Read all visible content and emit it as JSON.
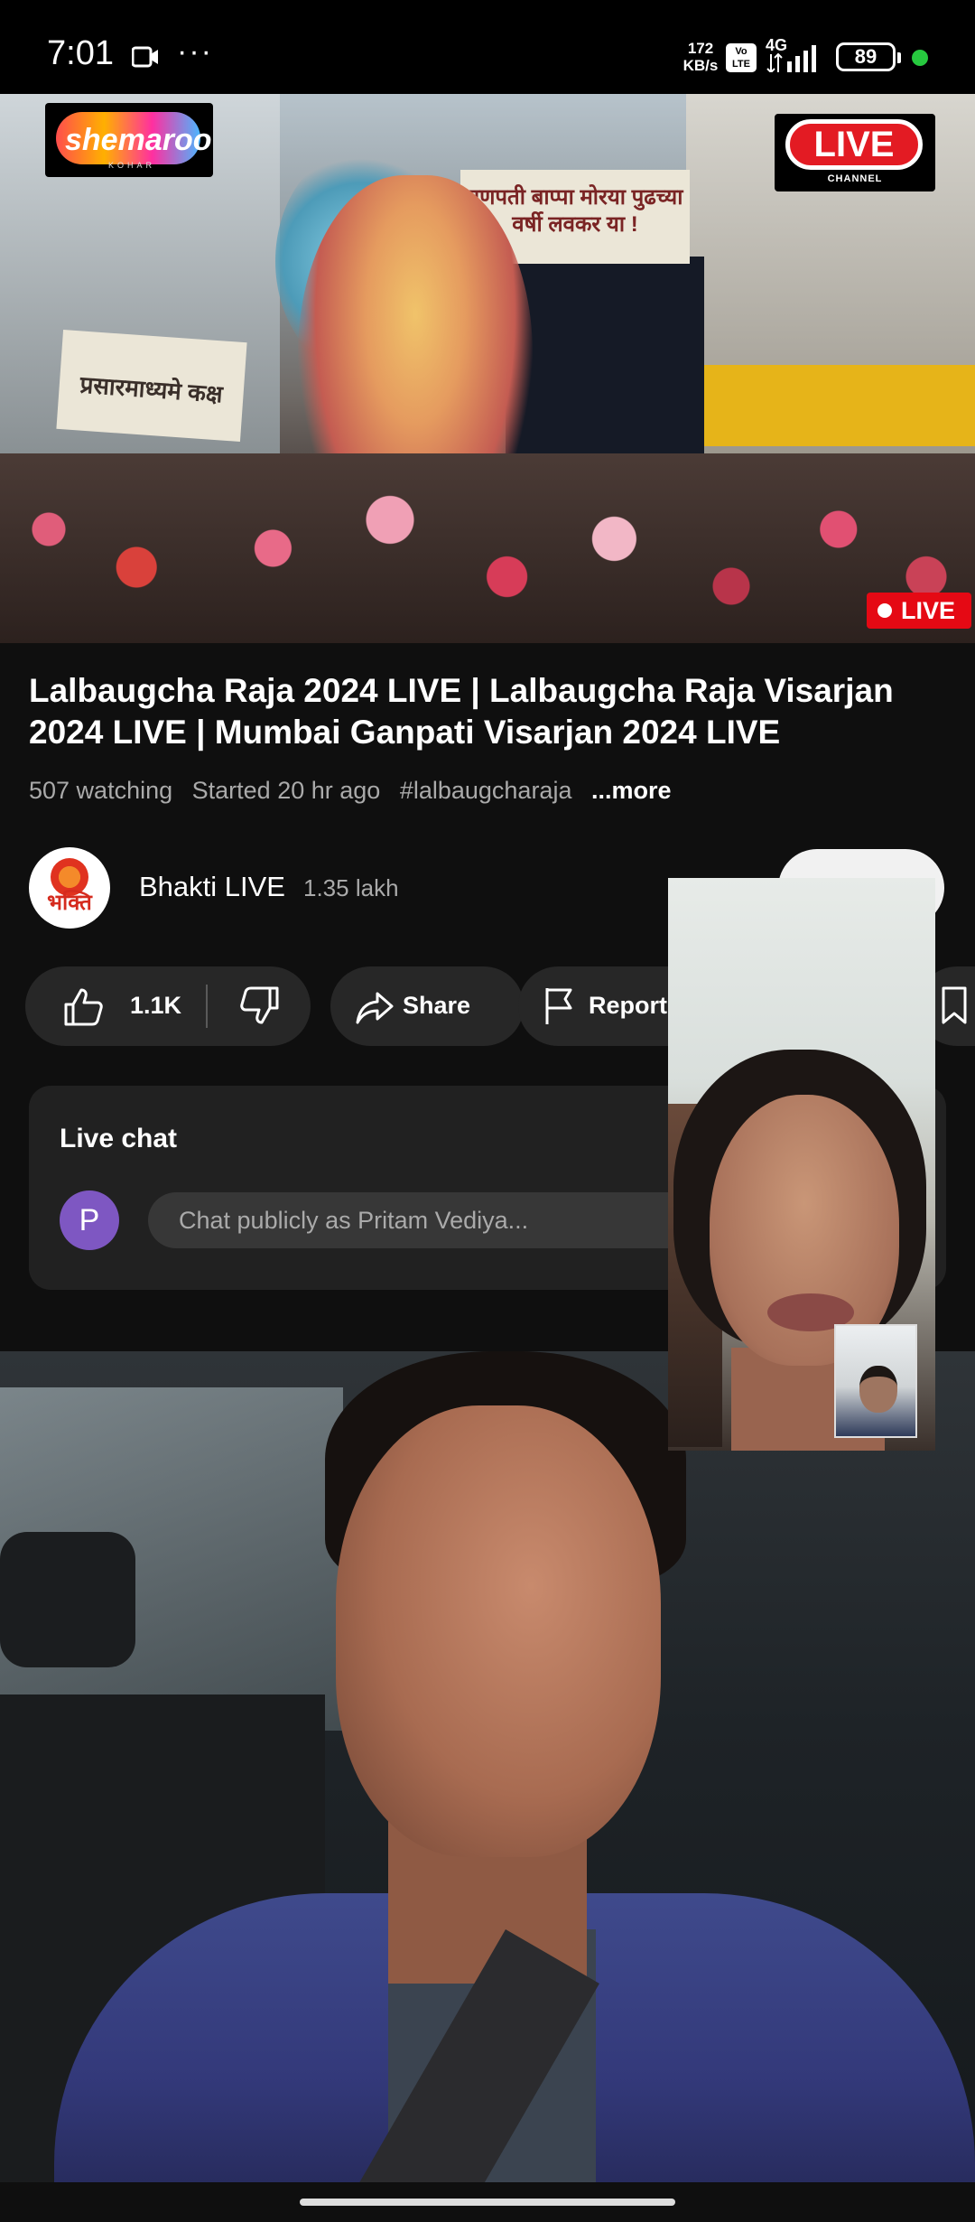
{
  "status_bar": {
    "time": "7:01",
    "more": "···",
    "net_speed_value": "172",
    "net_speed_unit": "KB/s",
    "volte": "Vo LTE",
    "network": "4G",
    "battery": "89"
  },
  "video": {
    "logo_text": "shemaroo",
    "logo_subtext": "KOHAR",
    "channel_logo_text": "LIVE",
    "channel_logo_sub": "CHANNEL",
    "banner_top": "गणपती बाप्पा मोरया पुढच्या वर्षी लवकर या !",
    "banner_left": "प्रसारमाध्यमे कक्ष",
    "live_badge": "LIVE"
  },
  "info": {
    "title": "Lalbaugcha Raja 2024 LIVE | Lalbaugcha Raja Visarjan 2024 LIVE | Mumbai Ganpati Visarjan 2024 LIVE",
    "watching": "507 watching",
    "started": "Started 20 hr ago",
    "hashtag": "#lalbaugcharaja",
    "more": "...more"
  },
  "channel": {
    "name": "Bhakti LIVE",
    "subscribers": "1.35 lakh"
  },
  "actions": {
    "like_count": "1.1K",
    "share": "Share",
    "report": "Report",
    "save_partial": "S"
  },
  "live_chat": {
    "title": "Live chat",
    "avatar_letter": "P",
    "placeholder": "Chat publicly as Pritam Vediya..."
  }
}
